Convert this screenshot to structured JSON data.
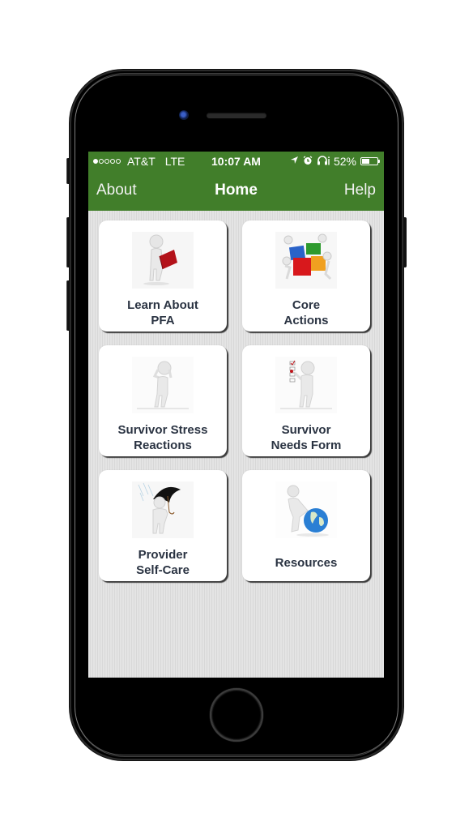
{
  "status_bar": {
    "signal_bars_filled": 1,
    "signal_bars_total": 5,
    "carrier": "AT&T",
    "network": "LTE",
    "time": "10:07 AM",
    "icons": [
      "location-arrow-icon",
      "alarm-icon",
      "headphones-icon"
    ],
    "battery_percent_label": "52%",
    "battery_level": 0.52
  },
  "navbar": {
    "left_label": "About",
    "title": "Home",
    "right_label": "Help"
  },
  "colors": {
    "header_green": "#417e2a",
    "tile_text": "#2a3342",
    "background": "#e0e0e0"
  },
  "tiles": [
    {
      "label": "Learn About\nPFA",
      "icon": "person-reading-book-icon"
    },
    {
      "label": "Core\nActions",
      "icon": "people-assembling-cubes-icon"
    },
    {
      "label": "Survivor Stress\nReactions",
      "icon": "stressed-person-icon"
    },
    {
      "label": "Survivor\nNeeds Form",
      "icon": "person-checklist-icon"
    },
    {
      "label": "Provider\nSelf-Care",
      "icon": "person-umbrella-icon"
    },
    {
      "label": "Resources",
      "icon": "person-globe-icon"
    }
  ]
}
